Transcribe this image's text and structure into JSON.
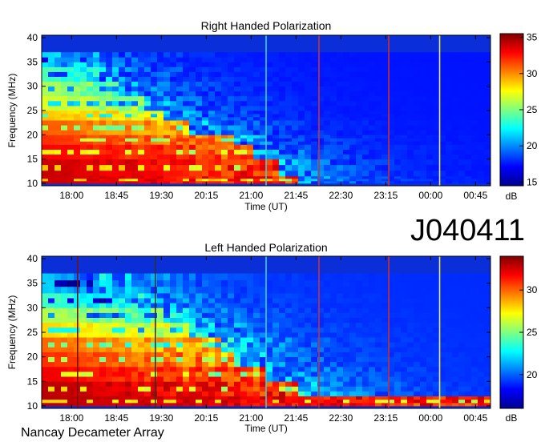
{
  "observation_id": "J040411",
  "footer": "Nancay Decameter Array",
  "colormap": [
    "#00008f",
    "#0000ff",
    "#007fff",
    "#00ffff",
    "#7fff7f",
    "#ffff00",
    "#ff7f00",
    "#ff0000",
    "#7f0000"
  ],
  "chart_data": [
    {
      "type": "heatmap",
      "title": "Right Handed Polarization",
      "xlabel": "Time (UT)",
      "ylabel": "Frequency (MHz)",
      "x_ticks": [
        "18:00",
        "18:45",
        "19:30",
        "20:15",
        "21:00",
        "21:45",
        "22:30",
        "23:15",
        "00:00",
        "00:45"
      ],
      "y_ticks": [
        10,
        15,
        20,
        25,
        30,
        35,
        40
      ],
      "ylim": [
        9.5,
        40.5
      ],
      "colorbar": {
        "label": "dB",
        "ticks": [
          15,
          20,
          25,
          30,
          35
        ],
        "range": [
          14.5,
          35.5
        ]
      },
      "marker_lines": [
        {
          "time": "21:15",
          "color": "#39d0d0"
        },
        {
          "time": "22:08",
          "color": "#d03030"
        },
        {
          "time": "23:18",
          "color": "#d03030"
        },
        {
          "time": "00:09",
          "color": "#e6e65a"
        }
      ],
      "bands": [
        {
          "freq": [
            10,
            11.5
          ],
          "level": 34,
          "end": "21:45"
        },
        {
          "freq": [
            11.5,
            15
          ],
          "level": 34,
          "end": "21:30"
        },
        {
          "freq": [
            15,
            18
          ],
          "level": 33,
          "end": "21:00"
        },
        {
          "freq": [
            18,
            20
          ],
          "level": 32,
          "end": "20:45"
        },
        {
          "freq": [
            20,
            23
          ],
          "level": 31,
          "end": "20:00"
        },
        {
          "freq": [
            23,
            25
          ],
          "level": 29,
          "end": "19:30"
        },
        {
          "freq": [
            25,
            28
          ],
          "level": 27,
          "end": "19:15"
        },
        {
          "freq": [
            28,
            31
          ],
          "level": 26,
          "end": "18:45"
        },
        {
          "freq": [
            31,
            34
          ],
          "level": 24,
          "end": "18:30"
        },
        {
          "freq": [
            34,
            37
          ],
          "level": 22,
          "end": "18:00"
        }
      ]
    },
    {
      "type": "heatmap",
      "title": "Left Handed Polarization",
      "xlabel": "Time (UT)",
      "ylabel": "Frequency (MHz)",
      "x_ticks": [
        "18:00",
        "18:45",
        "19:30",
        "20:15",
        "21:00",
        "21:45",
        "22:30",
        "23:15",
        "00:00",
        "00:45"
      ],
      "y_ticks": [
        10,
        15,
        20,
        25,
        30,
        35,
        40
      ],
      "ylim": [
        9.5,
        40.5
      ],
      "colorbar": {
        "label": "dB",
        "ticks": [
          20,
          25,
          30
        ],
        "range": [
          16,
          34
        ]
      },
      "marker_lines": [
        {
          "time": "18:06",
          "color": "#7a1010"
        },
        {
          "time": "19:24",
          "color": "#303030"
        },
        {
          "time": "21:15",
          "color": "#39d0d0"
        },
        {
          "time": "22:08",
          "color": "#d03030"
        },
        {
          "time": "23:18",
          "color": "#d03030"
        },
        {
          "time": "00:09",
          "color": "#e6e65a"
        }
      ],
      "bands": [
        {
          "freq": [
            10,
            12
          ],
          "level": 33,
          "end": "01:00"
        },
        {
          "freq": [
            12,
            15
          ],
          "level": 33,
          "end": "21:45"
        },
        {
          "freq": [
            15,
            18
          ],
          "level": 32,
          "end": "21:15"
        },
        {
          "freq": [
            18,
            21
          ],
          "level": 31,
          "end": "20:45"
        },
        {
          "freq": [
            21,
            24
          ],
          "level": 30,
          "end": "20:30"
        },
        {
          "freq": [
            24,
            27
          ],
          "level": 28,
          "end": "20:00"
        },
        {
          "freq": [
            27,
            30
          ],
          "level": 26,
          "end": "19:30"
        },
        {
          "freq": [
            30,
            33
          ],
          "level": 24,
          "end": "19:00"
        },
        {
          "freq": [
            33,
            37
          ],
          "level": 22,
          "end": "18:30"
        }
      ]
    }
  ]
}
